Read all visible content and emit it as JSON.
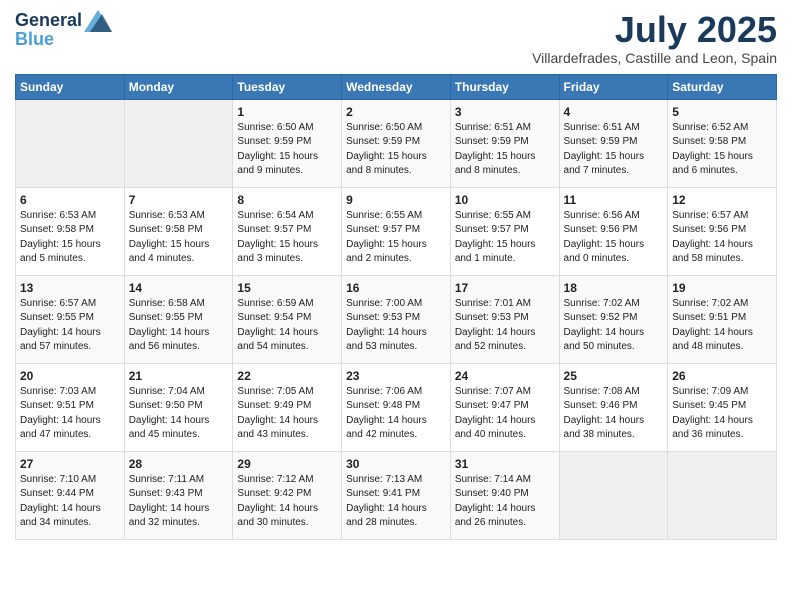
{
  "header": {
    "logo_line1": "General",
    "logo_line2": "Blue",
    "month": "July 2025",
    "location": "Villardefrades, Castille and Leon, Spain"
  },
  "weekdays": [
    "Sunday",
    "Monday",
    "Tuesday",
    "Wednesday",
    "Thursday",
    "Friday",
    "Saturday"
  ],
  "weeks": [
    [
      {
        "day": "",
        "info": ""
      },
      {
        "day": "",
        "info": ""
      },
      {
        "day": "1",
        "info": "Sunrise: 6:50 AM\nSunset: 9:59 PM\nDaylight: 15 hours and 9 minutes."
      },
      {
        "day": "2",
        "info": "Sunrise: 6:50 AM\nSunset: 9:59 PM\nDaylight: 15 hours and 8 minutes."
      },
      {
        "day": "3",
        "info": "Sunrise: 6:51 AM\nSunset: 9:59 PM\nDaylight: 15 hours and 8 minutes."
      },
      {
        "day": "4",
        "info": "Sunrise: 6:51 AM\nSunset: 9:59 PM\nDaylight: 15 hours and 7 minutes."
      },
      {
        "day": "5",
        "info": "Sunrise: 6:52 AM\nSunset: 9:58 PM\nDaylight: 15 hours and 6 minutes."
      }
    ],
    [
      {
        "day": "6",
        "info": "Sunrise: 6:53 AM\nSunset: 9:58 PM\nDaylight: 15 hours and 5 minutes."
      },
      {
        "day": "7",
        "info": "Sunrise: 6:53 AM\nSunset: 9:58 PM\nDaylight: 15 hours and 4 minutes."
      },
      {
        "day": "8",
        "info": "Sunrise: 6:54 AM\nSunset: 9:57 PM\nDaylight: 15 hours and 3 minutes."
      },
      {
        "day": "9",
        "info": "Sunrise: 6:55 AM\nSunset: 9:57 PM\nDaylight: 15 hours and 2 minutes."
      },
      {
        "day": "10",
        "info": "Sunrise: 6:55 AM\nSunset: 9:57 PM\nDaylight: 15 hours and 1 minute."
      },
      {
        "day": "11",
        "info": "Sunrise: 6:56 AM\nSunset: 9:56 PM\nDaylight: 15 hours and 0 minutes."
      },
      {
        "day": "12",
        "info": "Sunrise: 6:57 AM\nSunset: 9:56 PM\nDaylight: 14 hours and 58 minutes."
      }
    ],
    [
      {
        "day": "13",
        "info": "Sunrise: 6:57 AM\nSunset: 9:55 PM\nDaylight: 14 hours and 57 minutes."
      },
      {
        "day": "14",
        "info": "Sunrise: 6:58 AM\nSunset: 9:55 PM\nDaylight: 14 hours and 56 minutes."
      },
      {
        "day": "15",
        "info": "Sunrise: 6:59 AM\nSunset: 9:54 PM\nDaylight: 14 hours and 54 minutes."
      },
      {
        "day": "16",
        "info": "Sunrise: 7:00 AM\nSunset: 9:53 PM\nDaylight: 14 hours and 53 minutes."
      },
      {
        "day": "17",
        "info": "Sunrise: 7:01 AM\nSunset: 9:53 PM\nDaylight: 14 hours and 52 minutes."
      },
      {
        "day": "18",
        "info": "Sunrise: 7:02 AM\nSunset: 9:52 PM\nDaylight: 14 hours and 50 minutes."
      },
      {
        "day": "19",
        "info": "Sunrise: 7:02 AM\nSunset: 9:51 PM\nDaylight: 14 hours and 48 minutes."
      }
    ],
    [
      {
        "day": "20",
        "info": "Sunrise: 7:03 AM\nSunset: 9:51 PM\nDaylight: 14 hours and 47 minutes."
      },
      {
        "day": "21",
        "info": "Sunrise: 7:04 AM\nSunset: 9:50 PM\nDaylight: 14 hours and 45 minutes."
      },
      {
        "day": "22",
        "info": "Sunrise: 7:05 AM\nSunset: 9:49 PM\nDaylight: 14 hours and 43 minutes."
      },
      {
        "day": "23",
        "info": "Sunrise: 7:06 AM\nSunset: 9:48 PM\nDaylight: 14 hours and 42 minutes."
      },
      {
        "day": "24",
        "info": "Sunrise: 7:07 AM\nSunset: 9:47 PM\nDaylight: 14 hours and 40 minutes."
      },
      {
        "day": "25",
        "info": "Sunrise: 7:08 AM\nSunset: 9:46 PM\nDaylight: 14 hours and 38 minutes."
      },
      {
        "day": "26",
        "info": "Sunrise: 7:09 AM\nSunset: 9:45 PM\nDaylight: 14 hours and 36 minutes."
      }
    ],
    [
      {
        "day": "27",
        "info": "Sunrise: 7:10 AM\nSunset: 9:44 PM\nDaylight: 14 hours and 34 minutes."
      },
      {
        "day": "28",
        "info": "Sunrise: 7:11 AM\nSunset: 9:43 PM\nDaylight: 14 hours and 32 minutes."
      },
      {
        "day": "29",
        "info": "Sunrise: 7:12 AM\nSunset: 9:42 PM\nDaylight: 14 hours and 30 minutes."
      },
      {
        "day": "30",
        "info": "Sunrise: 7:13 AM\nSunset: 9:41 PM\nDaylight: 14 hours and 28 minutes."
      },
      {
        "day": "31",
        "info": "Sunrise: 7:14 AM\nSunset: 9:40 PM\nDaylight: 14 hours and 26 minutes."
      },
      {
        "day": "",
        "info": ""
      },
      {
        "day": "",
        "info": ""
      }
    ]
  ]
}
